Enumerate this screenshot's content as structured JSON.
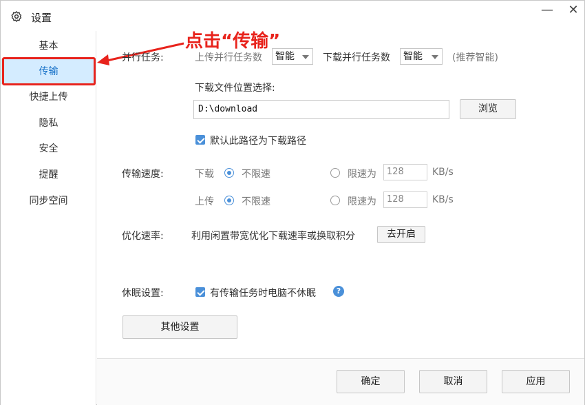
{
  "window": {
    "title": "设置",
    "settings_icon": "gear-icon",
    "minimize_label": "—",
    "close_label": "✕"
  },
  "sidebar": {
    "items": [
      {
        "label": "基本"
      },
      {
        "label": "传输"
      },
      {
        "label": "快捷上传"
      },
      {
        "label": "隐私"
      },
      {
        "label": "安全"
      },
      {
        "label": "提醒"
      },
      {
        "label": "同步空间"
      }
    ],
    "active_index": 1
  },
  "annotation": {
    "text": "点击“传输”",
    "color": "#e8231c"
  },
  "parallel_tasks": {
    "label": "并行任务:",
    "upload_label": "上传并行任务数",
    "upload_value": "智能",
    "download_label": "下载并行任务数",
    "download_value": "智能",
    "hint": "(推荐智能)"
  },
  "download_location": {
    "label": "下载文件位置选择:",
    "path": "D:\\download",
    "browse_label": "浏览",
    "default_checkbox_label": "默认此路径为下载路径",
    "default_checked": true
  },
  "transfer_speed": {
    "label": "传输速度:",
    "download": {
      "label": "下载",
      "unlimited_label": "不限速",
      "limit_label": "限速为",
      "limit_value": "128",
      "unit": "KB/s",
      "mode": "unlimited"
    },
    "upload": {
      "label": "上传",
      "unlimited_label": "不限速",
      "limit_label": "限速为",
      "limit_value": "128",
      "unit": "KB/s",
      "mode": "unlimited"
    }
  },
  "optimize": {
    "label": "优化速率:",
    "description": "利用闲置带宽优化下载速率或换取积分",
    "button_label": "去开启"
  },
  "sleep": {
    "label": "休眠设置:",
    "checkbox_label": "有传输任务时电脑不休眠",
    "checked": true,
    "help_icon": "question-icon",
    "help_glyph": "?"
  },
  "other_settings_label": "其他设置",
  "footer": {
    "ok_label": "确定",
    "cancel_label": "取消",
    "apply_label": "应用"
  },
  "colors": {
    "accent": "#4a90d9",
    "active_bg": "#d4ecff",
    "annotation": "#e8231c"
  }
}
